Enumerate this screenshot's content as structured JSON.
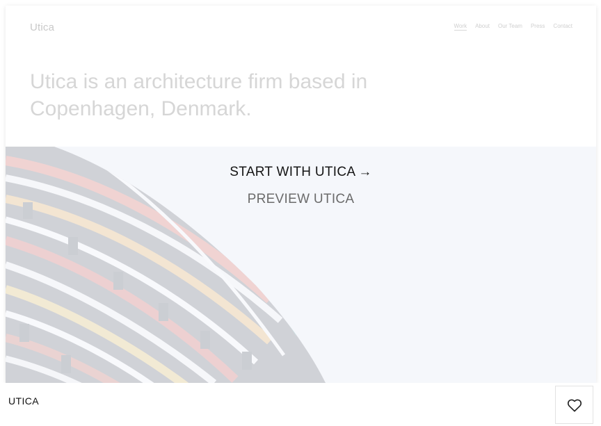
{
  "preview": {
    "logo": "Utica",
    "nav": [
      "Work",
      "About",
      "Our Team",
      "Press",
      "Contact"
    ],
    "heading": "Utica is an architecture firm based in Copenhagen, Denmark."
  },
  "actions": {
    "start_label": "START WITH UTICA",
    "start_arrow": "→",
    "preview_label": "PREVIEW UTICA"
  },
  "footer": {
    "template_name": "UTICA",
    "favorite_icon": "heart-icon"
  }
}
